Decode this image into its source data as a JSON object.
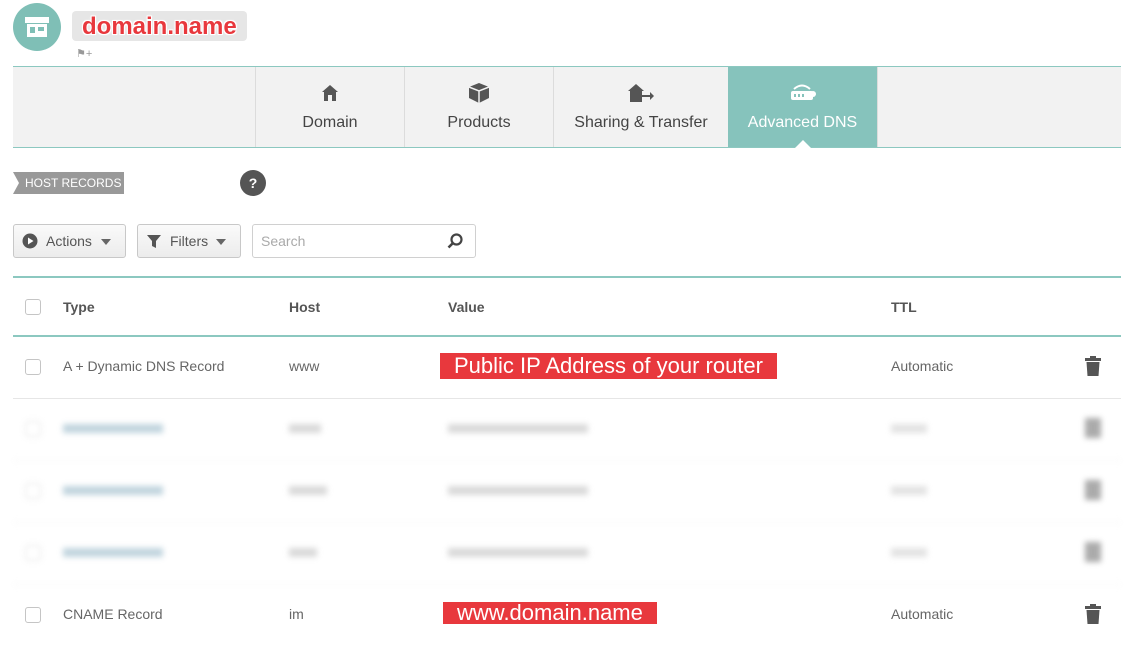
{
  "header": {
    "domain_title": "domain.name",
    "avatar_icon": "store-icon",
    "tag_icon": "tag-add-icon"
  },
  "tabs": [
    {
      "label": "Domain",
      "icon": "home-icon"
    },
    {
      "label": "Products",
      "icon": "box-icon"
    },
    {
      "label": "Sharing & Transfer",
      "icon": "house-arrow-icon"
    },
    {
      "label": "Advanced DNS",
      "icon": "router-icon",
      "active": true
    }
  ],
  "section": {
    "label": "HOST RECORDS",
    "help": "?"
  },
  "toolbar": {
    "actions_label": "Actions",
    "filters_label": "Filters",
    "search_placeholder": "Search"
  },
  "table": {
    "headers": {
      "type": "Type",
      "host": "Host",
      "value": "Value",
      "ttl": "TTL"
    },
    "rows": [
      {
        "type": "A + Dynamic DNS Record",
        "host": "www",
        "value": "Public IP Address of your router",
        "ttl": "Automatic"
      },
      {
        "type": "CNAME Record",
        "host": "im",
        "value": "www.domain.name",
        "ttl": "Automatic"
      }
    ],
    "blurred_row_count": 3
  },
  "colors": {
    "accent": "#86c3bc",
    "highlight": "#e8383d"
  }
}
